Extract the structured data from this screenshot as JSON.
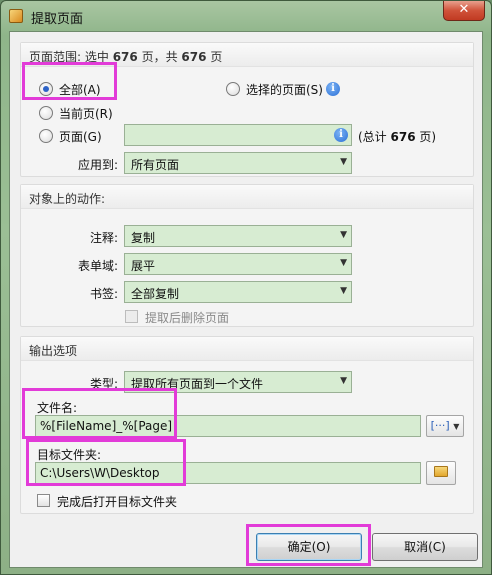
{
  "window": {
    "title": "提取页面",
    "close_glyph": "✕"
  },
  "page_range": {
    "header_prefix": "页面范围: 选中",
    "selected_count": "676",
    "header_mid": "页，共",
    "total_count": "676",
    "header_suffix": "页",
    "opt_all": "全部(A)",
    "opt_selected": "选择的页面(S)",
    "opt_current": "当前页(R)",
    "opt_pages": "页面(G)",
    "pages_value": "",
    "total_prefix": "(总计",
    "total_pages": "676",
    "total_suffix": "页)",
    "apply_to_label": "应用到:",
    "apply_to_value": "所有页面"
  },
  "object_actions": {
    "header": "对象上的动作:",
    "annotations_label": "注释:",
    "annotations_value": "复制",
    "form_fields_label": "表单域:",
    "form_fields_value": "展平",
    "bookmarks_label": "书签:",
    "bookmarks_value": "全部复制",
    "delete_after_label": "提取后删除页面"
  },
  "output": {
    "header": "输出选项",
    "type_label": "类型:",
    "type_value": "提取所有页面到一个文件",
    "filename_label": "文件名:",
    "filename_value": "%[FileName]_%[Page]",
    "macro_button": "[···]",
    "target_folder_label": "目标文件夹:",
    "target_folder_value": "C:\\Users\\W\\Desktop",
    "open_after_label": "完成后打开目标文件夹"
  },
  "buttons": {
    "ok": "确定(O)",
    "cancel": "取消(C)"
  },
  "icons": {
    "info": "info-icon",
    "folder": "folder-icon",
    "dropdown": "▼"
  },
  "colors": {
    "field_bg": "#d7ecd2",
    "highlight": "#e23bd8",
    "radio_dot": "#2d63c7"
  }
}
